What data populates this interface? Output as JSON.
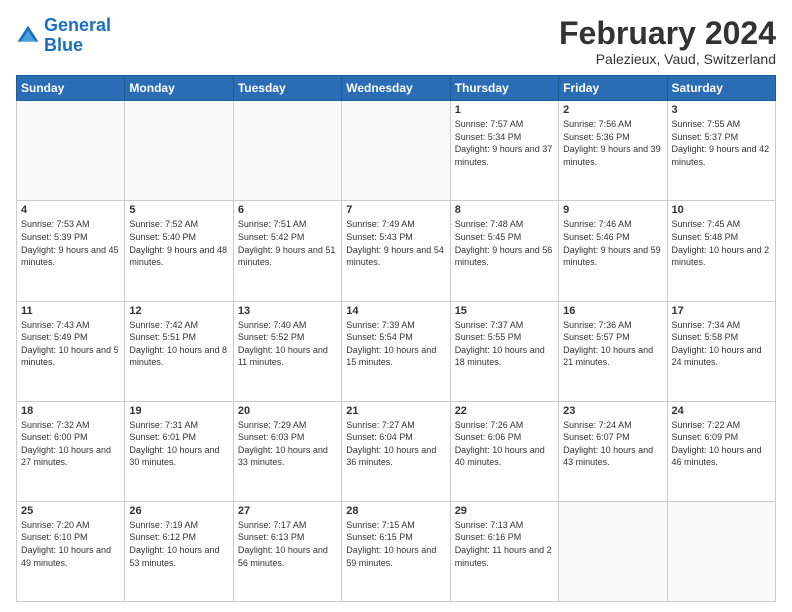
{
  "logo": {
    "text_general": "General",
    "text_blue": "Blue"
  },
  "header": {
    "month": "February 2024",
    "location": "Palezieux, Vaud, Switzerland"
  },
  "days_of_week": [
    "Sunday",
    "Monday",
    "Tuesday",
    "Wednesday",
    "Thursday",
    "Friday",
    "Saturday"
  ],
  "weeks": [
    [
      {
        "day": "",
        "info": ""
      },
      {
        "day": "",
        "info": ""
      },
      {
        "day": "",
        "info": ""
      },
      {
        "day": "",
        "info": ""
      },
      {
        "day": "1",
        "info": "Sunrise: 7:57 AM\nSunset: 5:34 PM\nDaylight: 9 hours and 37 minutes."
      },
      {
        "day": "2",
        "info": "Sunrise: 7:56 AM\nSunset: 5:36 PM\nDaylight: 9 hours and 39 minutes."
      },
      {
        "day": "3",
        "info": "Sunrise: 7:55 AM\nSunset: 5:37 PM\nDaylight: 9 hours and 42 minutes."
      }
    ],
    [
      {
        "day": "4",
        "info": "Sunrise: 7:53 AM\nSunset: 5:39 PM\nDaylight: 9 hours and 45 minutes."
      },
      {
        "day": "5",
        "info": "Sunrise: 7:52 AM\nSunset: 5:40 PM\nDaylight: 9 hours and 48 minutes."
      },
      {
        "day": "6",
        "info": "Sunrise: 7:51 AM\nSunset: 5:42 PM\nDaylight: 9 hours and 51 minutes."
      },
      {
        "day": "7",
        "info": "Sunrise: 7:49 AM\nSunset: 5:43 PM\nDaylight: 9 hours and 54 minutes."
      },
      {
        "day": "8",
        "info": "Sunrise: 7:48 AM\nSunset: 5:45 PM\nDaylight: 9 hours and 56 minutes."
      },
      {
        "day": "9",
        "info": "Sunrise: 7:46 AM\nSunset: 5:46 PM\nDaylight: 9 hours and 59 minutes."
      },
      {
        "day": "10",
        "info": "Sunrise: 7:45 AM\nSunset: 5:48 PM\nDaylight: 10 hours and 2 minutes."
      }
    ],
    [
      {
        "day": "11",
        "info": "Sunrise: 7:43 AM\nSunset: 5:49 PM\nDaylight: 10 hours and 5 minutes."
      },
      {
        "day": "12",
        "info": "Sunrise: 7:42 AM\nSunset: 5:51 PM\nDaylight: 10 hours and 8 minutes."
      },
      {
        "day": "13",
        "info": "Sunrise: 7:40 AM\nSunset: 5:52 PM\nDaylight: 10 hours and 11 minutes."
      },
      {
        "day": "14",
        "info": "Sunrise: 7:39 AM\nSunset: 5:54 PM\nDaylight: 10 hours and 15 minutes."
      },
      {
        "day": "15",
        "info": "Sunrise: 7:37 AM\nSunset: 5:55 PM\nDaylight: 10 hours and 18 minutes."
      },
      {
        "day": "16",
        "info": "Sunrise: 7:36 AM\nSunset: 5:57 PM\nDaylight: 10 hours and 21 minutes."
      },
      {
        "day": "17",
        "info": "Sunrise: 7:34 AM\nSunset: 5:58 PM\nDaylight: 10 hours and 24 minutes."
      }
    ],
    [
      {
        "day": "18",
        "info": "Sunrise: 7:32 AM\nSunset: 6:00 PM\nDaylight: 10 hours and 27 minutes."
      },
      {
        "day": "19",
        "info": "Sunrise: 7:31 AM\nSunset: 6:01 PM\nDaylight: 10 hours and 30 minutes."
      },
      {
        "day": "20",
        "info": "Sunrise: 7:29 AM\nSunset: 6:03 PM\nDaylight: 10 hours and 33 minutes."
      },
      {
        "day": "21",
        "info": "Sunrise: 7:27 AM\nSunset: 6:04 PM\nDaylight: 10 hours and 36 minutes."
      },
      {
        "day": "22",
        "info": "Sunrise: 7:26 AM\nSunset: 6:06 PM\nDaylight: 10 hours and 40 minutes."
      },
      {
        "day": "23",
        "info": "Sunrise: 7:24 AM\nSunset: 6:07 PM\nDaylight: 10 hours and 43 minutes."
      },
      {
        "day": "24",
        "info": "Sunrise: 7:22 AM\nSunset: 6:09 PM\nDaylight: 10 hours and 46 minutes."
      }
    ],
    [
      {
        "day": "25",
        "info": "Sunrise: 7:20 AM\nSunset: 6:10 PM\nDaylight: 10 hours and 49 minutes."
      },
      {
        "day": "26",
        "info": "Sunrise: 7:19 AM\nSunset: 6:12 PM\nDaylight: 10 hours and 53 minutes."
      },
      {
        "day": "27",
        "info": "Sunrise: 7:17 AM\nSunset: 6:13 PM\nDaylight: 10 hours and 56 minutes."
      },
      {
        "day": "28",
        "info": "Sunrise: 7:15 AM\nSunset: 6:15 PM\nDaylight: 10 hours and 59 minutes."
      },
      {
        "day": "29",
        "info": "Sunrise: 7:13 AM\nSunset: 6:16 PM\nDaylight: 11 hours and 2 minutes."
      },
      {
        "day": "",
        "info": ""
      },
      {
        "day": "",
        "info": ""
      }
    ]
  ]
}
